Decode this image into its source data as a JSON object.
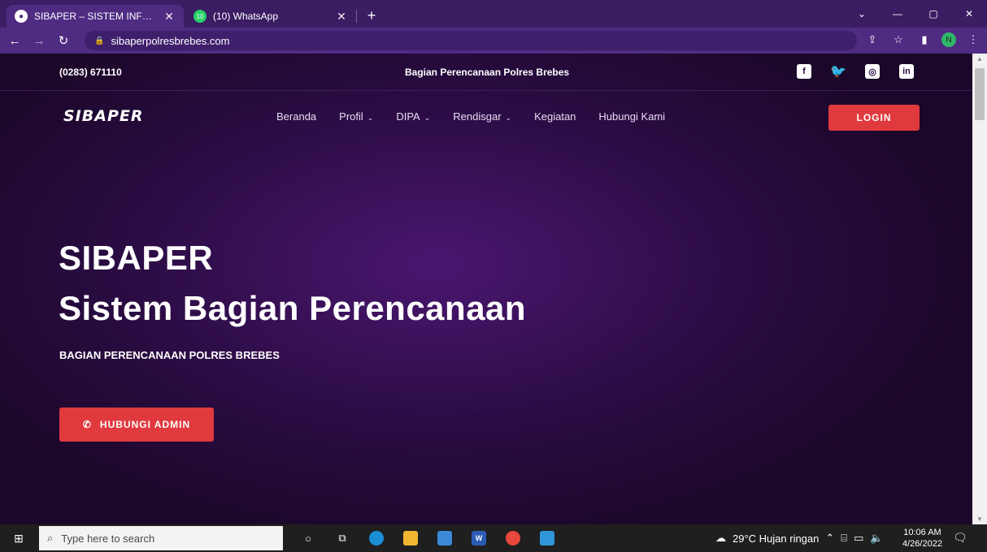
{
  "browser": {
    "tabs": [
      {
        "title": "SIBAPER – SISTEM INFORMASI B",
        "close": "✕"
      },
      {
        "title": "(10) WhatsApp",
        "badge": "10",
        "close": "✕"
      }
    ],
    "new_tab": "+",
    "url": "sibaperpolresbrebes.com",
    "profile_initial": "N",
    "window_controls": [
      "⌄",
      "—",
      "▢",
      "✕"
    ]
  },
  "site": {
    "topbar": {
      "phone": "(0283) 671110",
      "tagline": "Bagian Perencanaan Polres Brebes",
      "socials": [
        "facebook-icon",
        "twitter-icon",
        "instagram-icon",
        "linkedin-icon"
      ]
    },
    "logo": "SIBAPER",
    "menu": [
      {
        "label": "Beranda",
        "dropdown": false
      },
      {
        "label": "Profil",
        "dropdown": true
      },
      {
        "label": "DIPA",
        "dropdown": true
      },
      {
        "label": "Rendisgar",
        "dropdown": true
      },
      {
        "label": "Kegiatan",
        "dropdown": false
      },
      {
        "label": "Hubungi Kami",
        "dropdown": false
      }
    ],
    "login_label": "LOGIN",
    "hero": {
      "title1": "SIBAPER",
      "title2": "Sistem Bagian Perencanaan",
      "subtitle": "BAGIAN PERENCANAAN POLRES BREBES",
      "cta_label": "HUBUNGI ADMIN"
    },
    "colors": {
      "accent": "#e0393e",
      "bg": "#2c0c45"
    }
  },
  "taskbar": {
    "search_placeholder": "Type here to search",
    "weather": "29°C  Hujan ringan",
    "time": "10:06 AM",
    "date": "4/26/2022"
  }
}
